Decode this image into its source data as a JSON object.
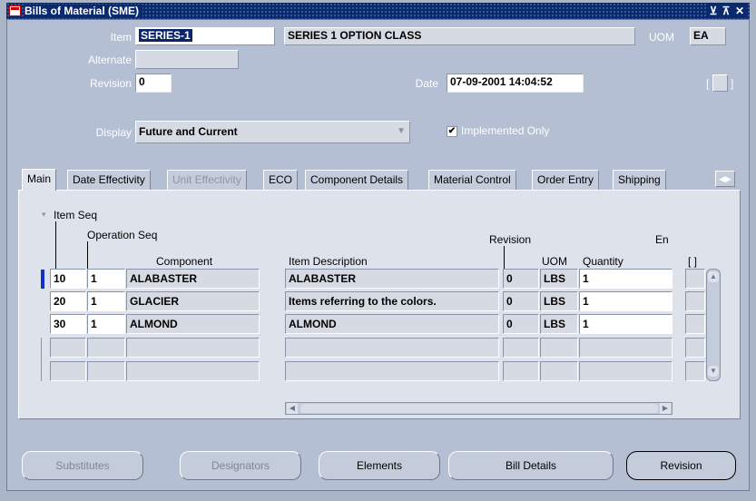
{
  "window": {
    "title": "Bills of Material (SME)"
  },
  "header": {
    "item_label": "Item",
    "item_value": "SERIES-1",
    "item_description": "SERIES 1 OPTION CLASS",
    "uom_label": "UOM",
    "uom_value": "EA",
    "alternate_label": "Alternate",
    "alternate_value": "",
    "revision_label": "Revision",
    "revision_value": "0",
    "date_label": "Date",
    "date_value": "07-09-2001 14:04:52",
    "display_label": "Display",
    "display_value": "Future and Current",
    "implemented_only_label": "Implemented Only",
    "implemented_only_checked": true
  },
  "tabs": [
    {
      "label": "Main",
      "active": true,
      "disabled": false
    },
    {
      "label": "Date Effectivity",
      "active": false,
      "disabled": false
    },
    {
      "label": "Unit Effectivity",
      "active": false,
      "disabled": true
    },
    {
      "label": "ECO",
      "active": false,
      "disabled": false
    },
    {
      "label": "Component Details",
      "active": false,
      "disabled": false
    },
    {
      "label": "Material Control",
      "active": false,
      "disabled": false
    },
    {
      "label": "Order Entry",
      "active": false,
      "disabled": false
    },
    {
      "label": "Shipping",
      "active": false,
      "disabled": false
    }
  ],
  "grid": {
    "headers": {
      "item_seq": "Item Seq",
      "operation_seq": "Operation Seq",
      "component": "Component",
      "item_description": "Item Description",
      "revision": "Revision",
      "uom": "UOM",
      "quantity": "Quantity",
      "extra": "En",
      "bracket": "[ ]"
    },
    "rows": [
      {
        "item_seq": "10",
        "operation_seq": "1",
        "component": "ALABASTER",
        "description": "ALABASTER",
        "revision": "0",
        "uom": "LBS",
        "quantity": "1"
      },
      {
        "item_seq": "20",
        "operation_seq": "1",
        "component": "GLACIER",
        "description": "Items referring to the colors.",
        "revision": "0",
        "uom": "LBS",
        "quantity": "1"
      },
      {
        "item_seq": "30",
        "operation_seq": "1",
        "component": "ALMOND",
        "description": "ALMOND",
        "revision": "0",
        "uom": "LBS",
        "quantity": "1"
      },
      {
        "item_seq": "",
        "operation_seq": "",
        "component": "",
        "description": "",
        "revision": "",
        "uom": "",
        "quantity": ""
      },
      {
        "item_seq": "",
        "operation_seq": "",
        "component": "",
        "description": "",
        "revision": "",
        "uom": "",
        "quantity": ""
      }
    ]
  },
  "buttons": {
    "substitutes": "Substitutes",
    "designators": "Designators",
    "elements": "Elements",
    "bill_details": "Bill Details",
    "revision": "Revision"
  },
  "misc": {
    "flex_bracket": "[ ]"
  }
}
